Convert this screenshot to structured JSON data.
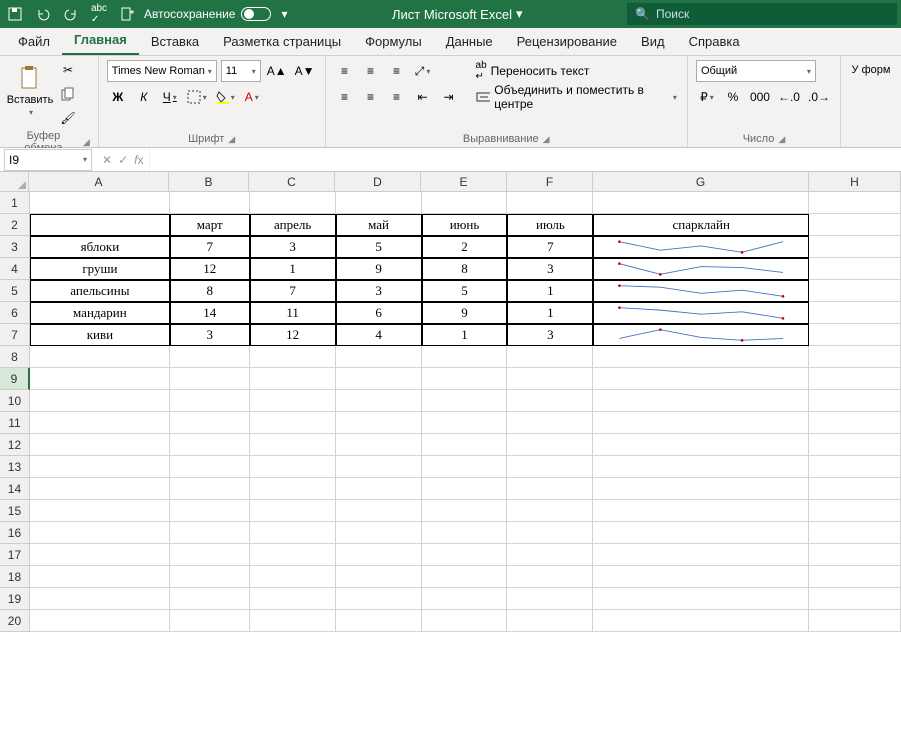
{
  "titlebar": {
    "autosave_label": "Автосохранение",
    "title": "Лист Microsoft Excel",
    "search_placeholder": "Поиск"
  },
  "tabs": {
    "file": "Файл",
    "home": "Главная",
    "insert": "Вставка",
    "layout": "Разметка страницы",
    "formulas": "Формулы",
    "data": "Данные",
    "review": "Рецензирование",
    "view": "Вид",
    "help": "Справка"
  },
  "ribbon": {
    "clipboard": {
      "label": "Буфер обмена",
      "paste": "Вставить"
    },
    "font": {
      "label": "Шрифт",
      "name": "Times New Roman",
      "size": "11",
      "bold": "Ж",
      "italic": "К",
      "underline": "Ч"
    },
    "align": {
      "label": "Выравнивание",
      "wrap": "Переносить текст",
      "merge": "Объединить и поместить в центре"
    },
    "number": {
      "label": "Число",
      "format": "Общий"
    },
    "styles_hint": "У форм"
  },
  "namebox": "I9",
  "columns": [
    "A",
    "B",
    "C",
    "D",
    "E",
    "F",
    "G",
    "H"
  ],
  "headers": {
    "A": "",
    "B": "март",
    "C": "апрель",
    "D": "май",
    "E": "июнь",
    "F": "июль",
    "G": "спарклайн"
  },
  "rows": [
    {
      "A": "яблоки",
      "B": 7,
      "C": 3,
      "D": 5,
      "E": 2,
      "F": 7
    },
    {
      "A": "груши",
      "B": 12,
      "C": 1,
      "D": 9,
      "E": 8,
      "F": 3
    },
    {
      "A": "апельсины",
      "B": 8,
      "C": 7,
      "D": 3,
      "E": 5,
      "F": 1
    },
    {
      "A": "мандарин",
      "B": 14,
      "C": 11,
      "D": 6,
      "E": 9,
      "F": 1
    },
    {
      "A": "киви",
      "B": 3,
      "C": 12,
      "D": 4,
      "E": 1,
      "F": 3
    }
  ],
  "chart_data": [
    {
      "type": "line",
      "categories": [
        "март",
        "апрель",
        "май",
        "июнь",
        "июль"
      ],
      "values": [
        7,
        3,
        5,
        2,
        7
      ],
      "series_name": "яблоки"
    },
    {
      "type": "line",
      "categories": [
        "март",
        "апрель",
        "май",
        "июнь",
        "июль"
      ],
      "values": [
        12,
        1,
        9,
        8,
        3
      ],
      "series_name": "груши"
    },
    {
      "type": "line",
      "categories": [
        "март",
        "апрель",
        "май",
        "июнь",
        "июль"
      ],
      "values": [
        8,
        7,
        3,
        5,
        1
      ],
      "series_name": "апельсины"
    },
    {
      "type": "line",
      "categories": [
        "март",
        "апрель",
        "май",
        "июнь",
        "июль"
      ],
      "values": [
        14,
        11,
        6,
        9,
        1
      ],
      "series_name": "мандарин"
    },
    {
      "type": "line",
      "categories": [
        "март",
        "апрель",
        "май",
        "июнь",
        "июль"
      ],
      "values": [
        3,
        12,
        4,
        1,
        3
      ],
      "series_name": "киви"
    }
  ],
  "active_cell": "I9",
  "total_rows": 20
}
